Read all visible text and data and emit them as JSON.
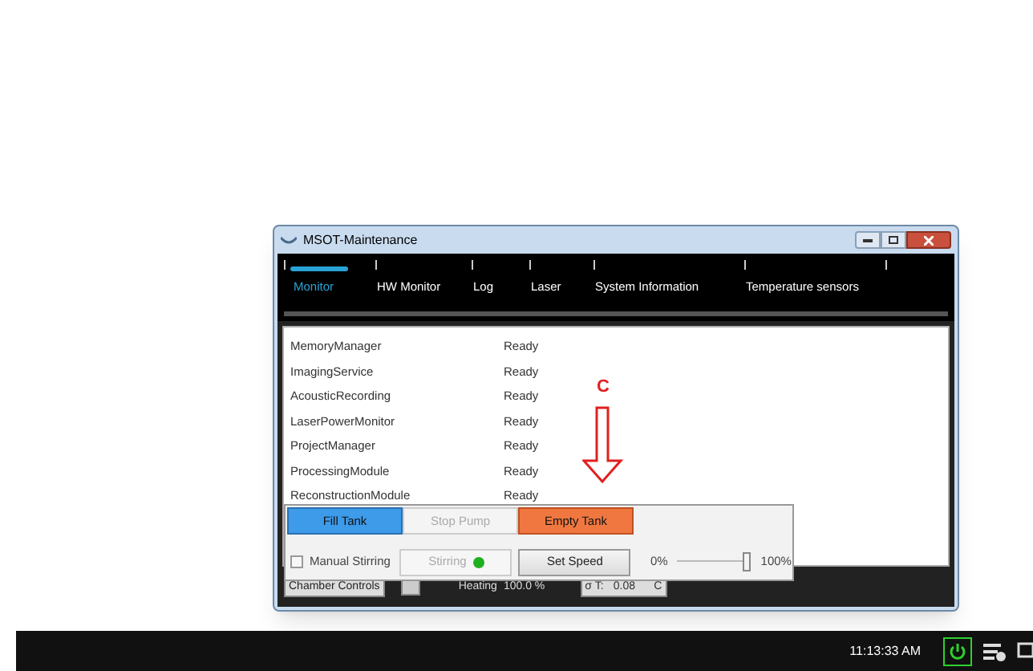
{
  "window": {
    "title": "MSOT-Maintenance"
  },
  "tabs": [
    {
      "label": "Monitor",
      "selected": true
    },
    {
      "label": "HW Monitor",
      "selected": false
    },
    {
      "label": "Log",
      "selected": false
    },
    {
      "label": "Laser",
      "selected": false
    },
    {
      "label": "System Information",
      "selected": false
    },
    {
      "label": "Temperature sensors",
      "selected": false
    }
  ],
  "services": [
    {
      "name": "MemoryManager",
      "status": "Ready"
    },
    {
      "name": "ImagingService",
      "status": "Ready"
    },
    {
      "name": "AcousticRecording",
      "status": "Ready"
    },
    {
      "name": "LaserPowerMonitor",
      "status": "Ready"
    },
    {
      "name": "ProjectManager",
      "status": "Ready"
    },
    {
      "name": "ProcessingModule",
      "status": "Ready"
    },
    {
      "name": "ReconstructionModule",
      "status": "Ready"
    }
  ],
  "annotation": {
    "label": "C"
  },
  "tank_buttons": [
    {
      "label": "Fill Tank",
      "kind": "fill",
      "disabled": false
    },
    {
      "label": "Stop Pump",
      "kind": "stop",
      "disabled": true
    },
    {
      "label": "Empty Tank",
      "kind": "empty",
      "disabled": false
    }
  ],
  "stirring": {
    "manual_label": "Manual Stirring",
    "checked": false,
    "stirring_button": "Stirring",
    "stirring_disabled": true,
    "set_speed": "Set Speed",
    "min_label": "0%",
    "max_label": "100%",
    "level": 0.95
  },
  "status_bar": {
    "chamber_controls": "Chamber Controls",
    "heating_label": "Heating",
    "heating_value": "100.0 %",
    "sigma_label": "σ T:",
    "sigma_value": "0.08",
    "sigma_unit": "C"
  },
  "taskbar": {
    "time": "11:13:33 AM"
  }
}
